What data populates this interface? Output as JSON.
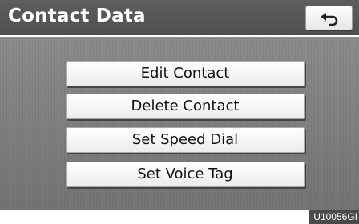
{
  "header": {
    "title": "Contact Data",
    "back_icon": "back-arrow-icon"
  },
  "menu": {
    "items": [
      {
        "label": "Edit Contact"
      },
      {
        "label": "Delete Contact"
      },
      {
        "label": "Set Speed Dial"
      },
      {
        "label": "Set Voice Tag"
      }
    ]
  },
  "figure_code": "U10056GI"
}
